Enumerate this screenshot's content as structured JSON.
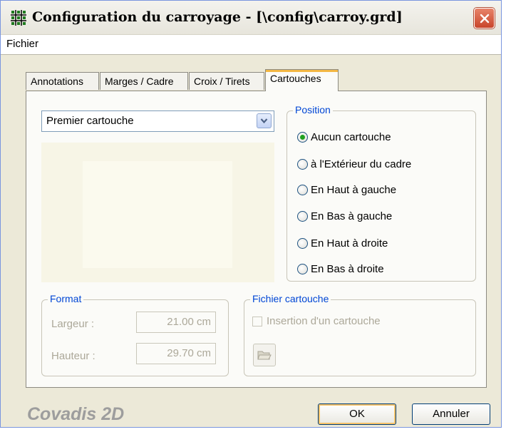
{
  "window": {
    "title": "Configuration  du carroyage - [\\config\\carroy.grd]",
    "icon": "grid-icon",
    "close_icon": "close-icon"
  },
  "menu": {
    "items": [
      "Fichier"
    ]
  },
  "tabs": [
    {
      "label": "Annotations",
      "active": false
    },
    {
      "label": "Marges / Cadre",
      "active": false
    },
    {
      "label": "Croix / Tirets",
      "active": false
    },
    {
      "label": "Cartouches",
      "active": true
    }
  ],
  "cartouche_select": {
    "value": "Premier cartouche"
  },
  "position": {
    "title": "Position",
    "options": [
      {
        "label": "Aucun cartouche",
        "selected": true
      },
      {
        "label": "à l'Extérieur du cadre",
        "selected": false
      },
      {
        "label": "En Haut à gauche",
        "selected": false
      },
      {
        "label": "En Bas à gauche",
        "selected": false
      },
      {
        "label": "En Haut à droite",
        "selected": false
      },
      {
        "label": "En Bas à droite",
        "selected": false
      }
    ]
  },
  "format": {
    "title": "Format",
    "width_label": "Largeur :",
    "width_value": "21.00 cm",
    "height_label": "Hauteur :",
    "height_value": "29.70 cm"
  },
  "fichier_cartouche": {
    "title": "Fichier cartouche",
    "checkbox_label": "Insertion d'un cartouche",
    "checked": false,
    "browse_icon": "folder-open-icon"
  },
  "footer": {
    "brand": "Covadis 2D",
    "ok_label": "OK",
    "cancel_label": "Annuler"
  },
  "colors": {
    "dialog_bg": "#ece9d8",
    "group_title": "#0046d5",
    "disabled_text": "#aca899",
    "radio_selected": "#21a121",
    "close_button": "#c8452b",
    "tab_highlight": "#f4b844"
  }
}
